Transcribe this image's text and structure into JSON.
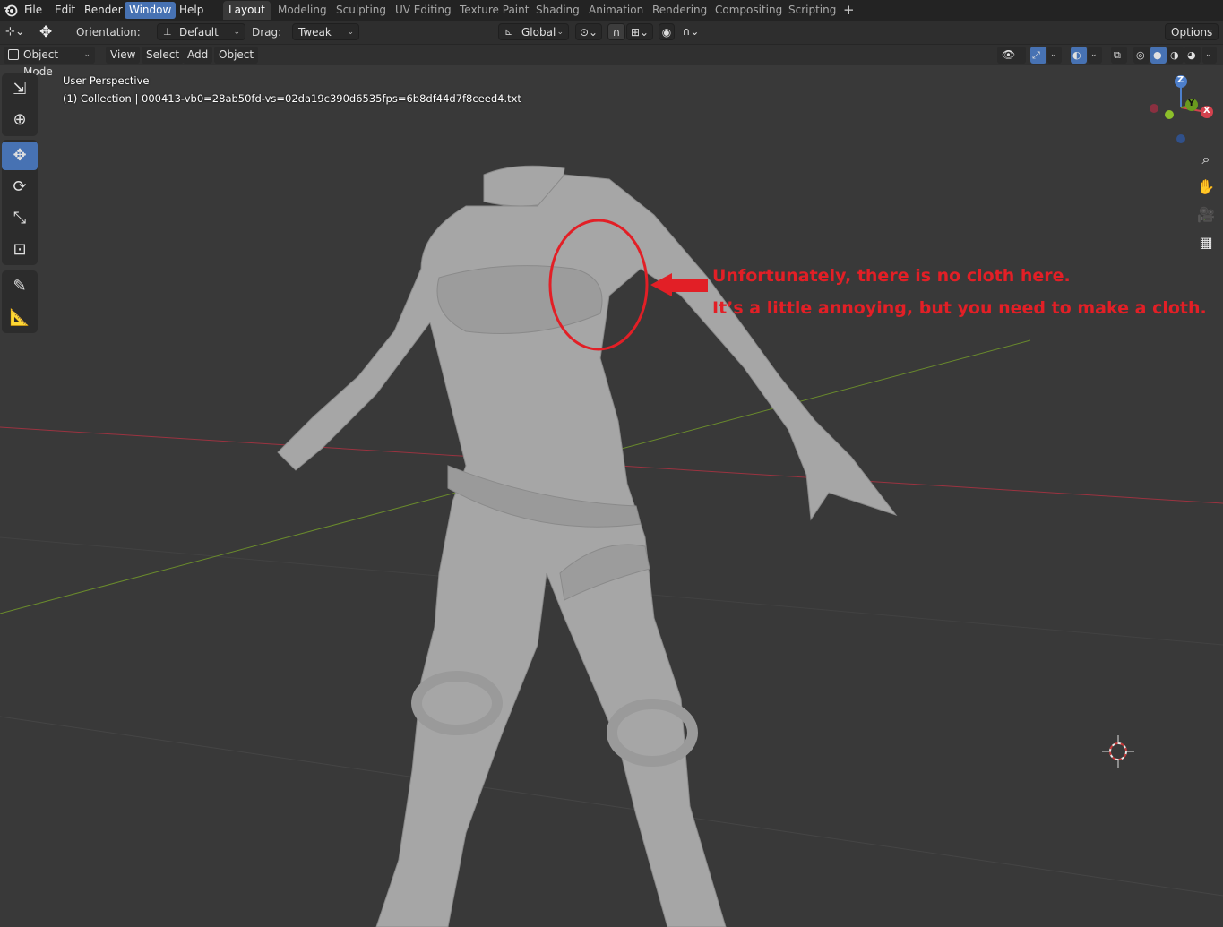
{
  "menu": {
    "items": [
      "File",
      "Edit",
      "Render",
      "Window",
      "Help"
    ],
    "active": "Window"
  },
  "workspaces": {
    "tabs": [
      "Layout",
      "Modeling",
      "Sculpting",
      "UV Editing",
      "Texture Paint",
      "Shading",
      "Animation",
      "Rendering",
      "Compositing",
      "Scripting"
    ],
    "active": "Layout",
    "add_label": "+"
  },
  "tool_settings": {
    "orientation_label": "Orientation:",
    "orientation_value": "Default",
    "drag_label": "Drag:",
    "drag_value": "Tweak",
    "transform_orientation": "Global",
    "options_label": "Options"
  },
  "header": {
    "mode": "Object Mode",
    "menus": [
      "View",
      "Select",
      "Add",
      "Object"
    ]
  },
  "viewport": {
    "perspective_label": "User Perspective",
    "collection_info": "(1) Collection | 000413-vb0=28ab50fd-vs=02da19c390d6535fps=6b8df44d7f8ceed4.txt"
  },
  "annotation": {
    "line1": "Unfortunately, there is no cloth here.",
    "line2": "It’s a little annoying, but you need to make a cloth.",
    "color": "#e21f26"
  },
  "gizmo": {
    "z": "Z",
    "y": "Y",
    "x": "X"
  },
  "colors": {
    "accent": "#4772b3",
    "viewport_bg": "#393939",
    "x_axis": "#9b3340",
    "y_axis": "#6a8b2c"
  },
  "icons": {
    "tools": [
      "select-box-icon",
      "cursor-icon",
      "move-icon",
      "rotate-icon",
      "scale-icon",
      "transform-icon",
      "annotate-icon",
      "measure-icon"
    ],
    "nav": [
      "zoom-icon",
      "pan-hand-icon",
      "camera-icon",
      "grid-ortho-icon"
    ]
  }
}
